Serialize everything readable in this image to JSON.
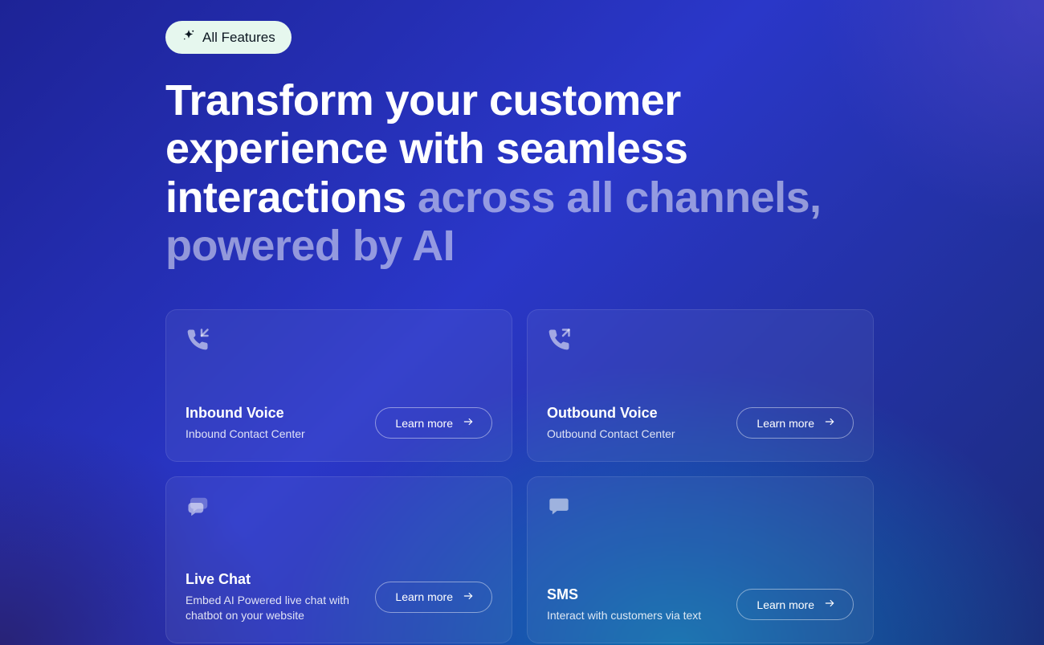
{
  "badge": {
    "label": "All Features"
  },
  "headline": {
    "main": "Transform your customer experience with seamless interactions",
    "muted": " across all channels, powered by AI"
  },
  "learn_label": "Learn more",
  "cards": [
    {
      "icon": "phone-incoming",
      "title": "Inbound Voice",
      "sub": "Inbound Contact Center"
    },
    {
      "icon": "phone-outgoing",
      "title": "Outbound Voice",
      "sub": "Outbound Contact Center"
    },
    {
      "icon": "chat-bubbles",
      "title": "Live Chat",
      "sub": "Embed AI Powered live chat with chatbot on your website"
    },
    {
      "icon": "speech-bubble",
      "title": "SMS",
      "sub": "Interact with customers via text"
    }
  ]
}
